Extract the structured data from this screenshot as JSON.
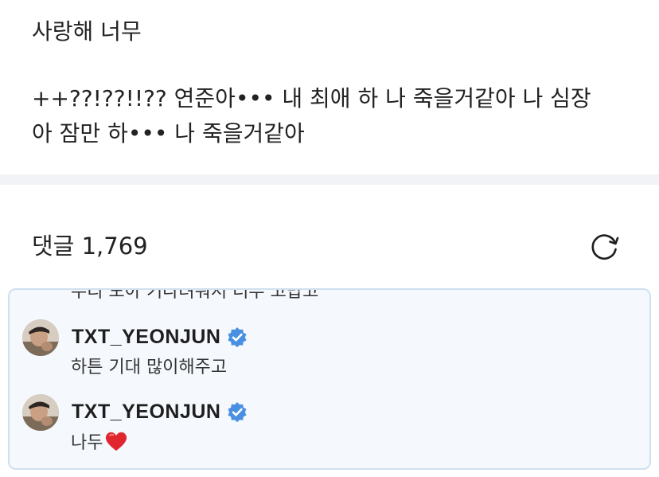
{
  "post": {
    "line1": "사랑해 너무",
    "line2": "++??!??!!?? 연준아••• 내 최애 하 나 죽을거같아 나 심장",
    "line3": "아 잠만 하••• 나 죽을거같아"
  },
  "comments": {
    "title": "댓글 1,769",
    "refresh_icon": "refresh-icon"
  },
  "chat": {
    "messages": [
      {
        "text": "우리 모아 기다려줘서 너무 고맙고"
      },
      {
        "author": "TXT_YEONJUN",
        "verified": true,
        "text": "하튼 기대 많이해주고"
      },
      {
        "author": "TXT_YEONJUN",
        "verified": true,
        "text": "나두",
        "emoji": "red-heart-icon"
      }
    ]
  },
  "colors": {
    "verified": "#4a90e2",
    "chat_border": "#cfe0ee",
    "chat_bg": "#f5f9fd",
    "divider": "#f2f3f6",
    "heart": "#e0262e"
  }
}
